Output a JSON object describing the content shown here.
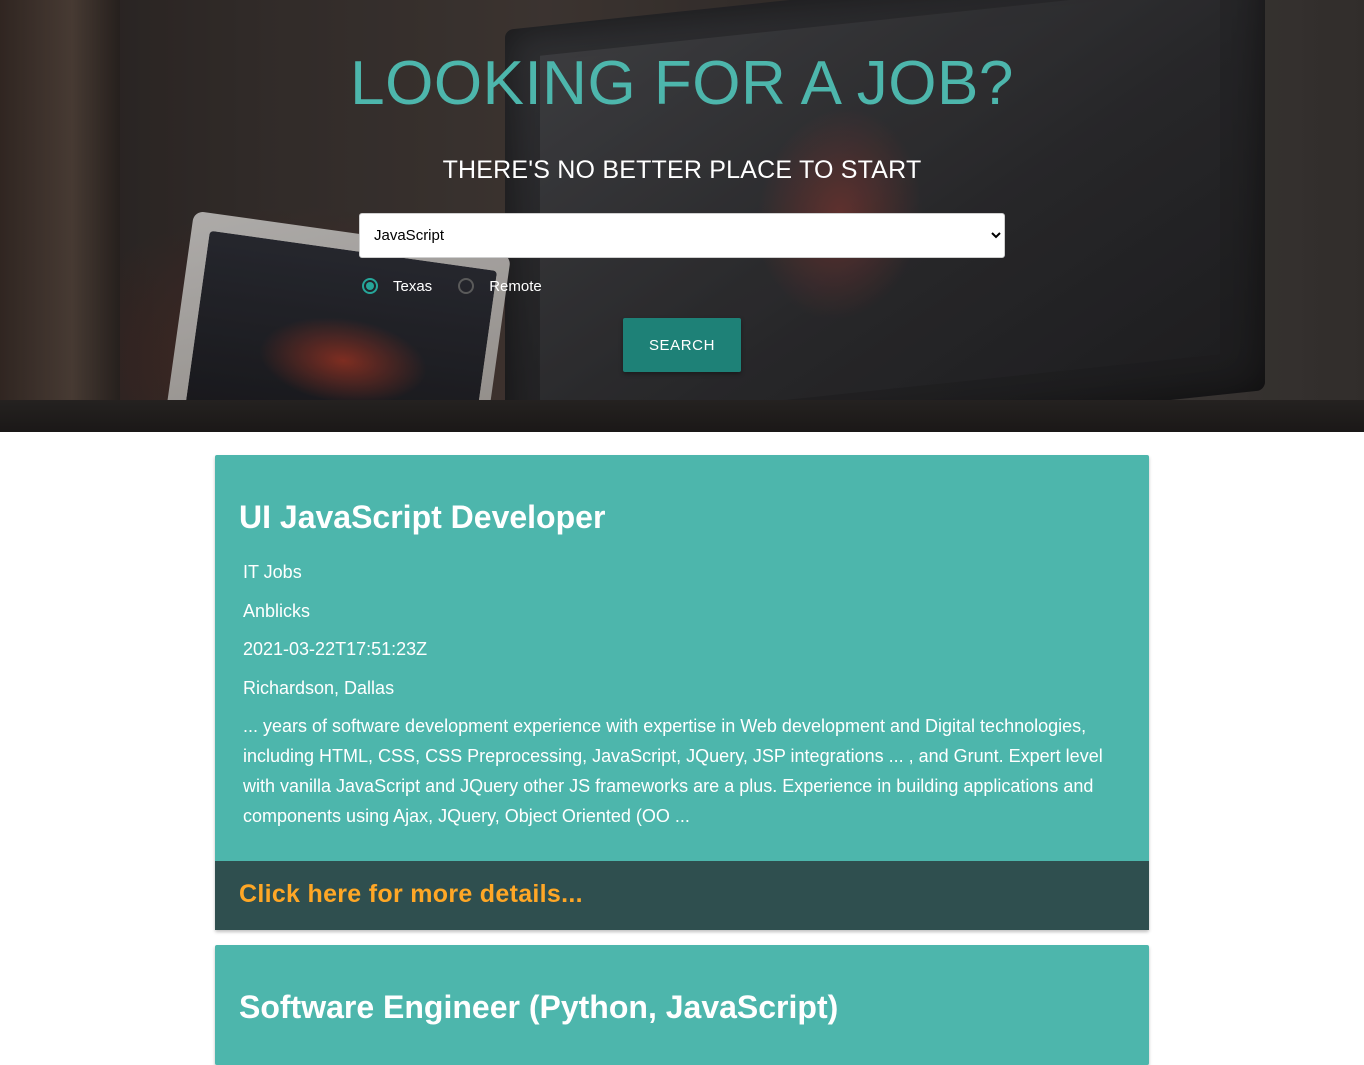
{
  "hero": {
    "title": "LOOKING FOR A JOB?",
    "subtitle": "THERE'S NO BETTER PLACE TO START",
    "search": {
      "selected": "JavaScript",
      "options": [
        "JavaScript"
      ]
    },
    "locations": [
      {
        "label": "Texas",
        "checked": true
      },
      {
        "label": "Remote",
        "checked": false
      }
    ],
    "search_button": "SEARCH"
  },
  "jobs": [
    {
      "title": "UI JavaScript Developer",
      "category": "IT Jobs",
      "company": "Anblicks",
      "posted": "2021-03-22T17:51:23Z",
      "location": "Richardson, Dallas",
      "description": "... years of software development experience with expertise in Web development and Digital technologies, including HTML, CSS, CSS Preprocessing, JavaScript, JQuery, JSP integrations ... , and Grunt. Expert level with vanilla JavaScript and JQuery other JS frameworks are a plus. Experience in building applications and components using Ajax, JQuery, Object Oriented (OO ...",
      "link_text": "Click here for more details..."
    },
    {
      "title": "Software Engineer (Python, JavaScript)"
    }
  ],
  "colors": {
    "accent": "#4db6ac",
    "button": "#1e8177",
    "footer": "#2f4f4f",
    "link": "#ffa726"
  }
}
